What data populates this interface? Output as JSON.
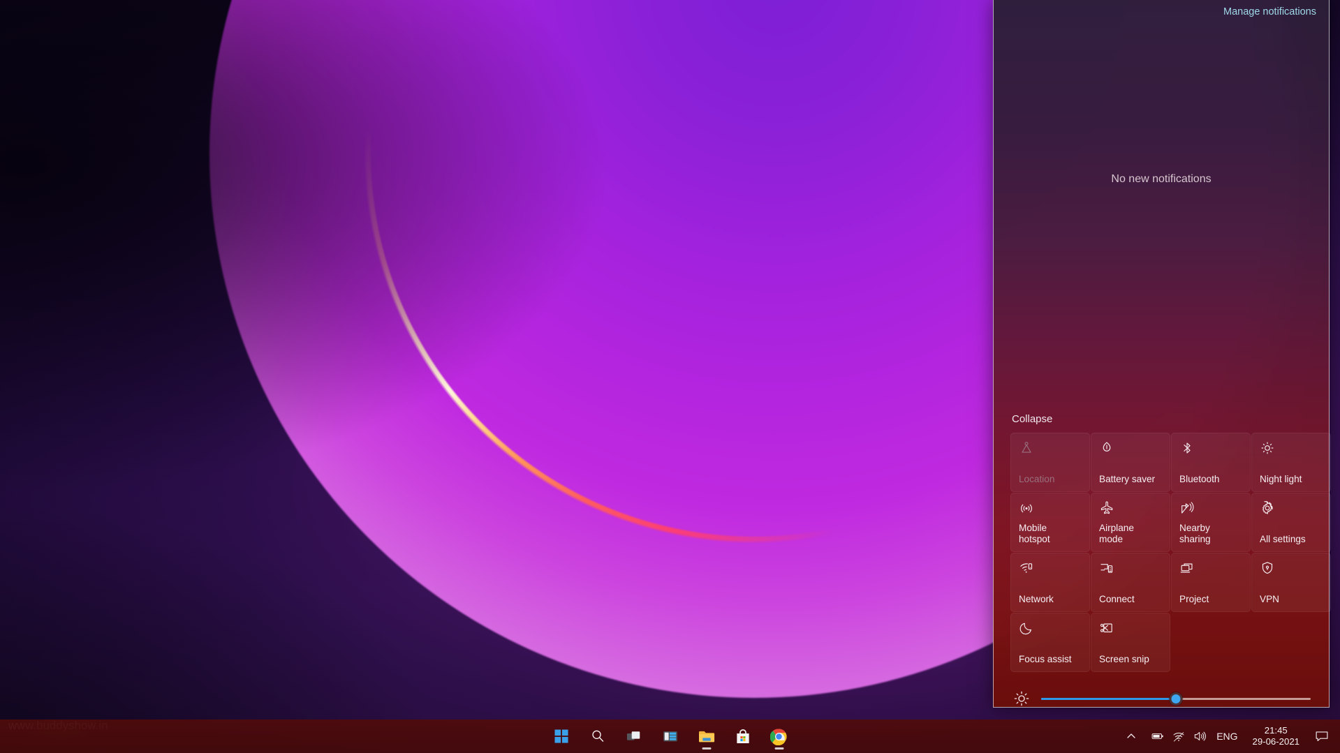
{
  "desktop": {
    "watermark": "www.buddyshow.in"
  },
  "action_center": {
    "manage_notifications": "Manage notifications",
    "no_notifications_text": "No new notifications",
    "collapse_label": "Collapse",
    "accent_color": "#2f9ae8",
    "link_color": "#9fd8e8",
    "quick_actions": [
      {
        "label": "Location",
        "icon": "location-icon",
        "enabled": false,
        "span": 1
      },
      {
        "label": "Battery saver",
        "icon": "battery-saver-icon",
        "enabled": true,
        "span": 1
      },
      {
        "label": "Bluetooth",
        "icon": "bluetooth-icon",
        "enabled": true,
        "span": 1
      },
      {
        "label": "Night light",
        "icon": "night-light-icon",
        "enabled": true,
        "span": 1
      },
      {
        "label": "Mobile\nhotspot",
        "icon": "mobile-hotspot-icon",
        "enabled": true,
        "span": 1
      },
      {
        "label": "Airplane\nmode",
        "icon": "airplane-mode-icon",
        "enabled": true,
        "span": 1
      },
      {
        "label": "Nearby\nsharing",
        "icon": "nearby-sharing-icon",
        "enabled": true,
        "span": 1
      },
      {
        "label": "All settings",
        "icon": "gear-icon",
        "enabled": true,
        "span": 1
      },
      {
        "label": "Network",
        "icon": "network-icon",
        "enabled": true,
        "span": 1
      },
      {
        "label": "Connect",
        "icon": "connect-icon",
        "enabled": true,
        "span": 1
      },
      {
        "label": "Project",
        "icon": "project-icon",
        "enabled": true,
        "span": 1
      },
      {
        "label": "VPN",
        "icon": "vpn-shield-icon",
        "enabled": true,
        "span": 1
      },
      {
        "label": "Focus assist",
        "icon": "moon-icon",
        "enabled": true,
        "span": 1
      },
      {
        "label": "Screen snip",
        "icon": "screen-snip-icon",
        "enabled": true,
        "span": 1
      }
    ],
    "brightness": {
      "icon": "brightness-icon",
      "value": 50,
      "min": 0,
      "max": 100
    }
  },
  "taskbar": {
    "buttons": [
      {
        "name": "start-button",
        "icon": "windows-logo-icon",
        "active": false
      },
      {
        "name": "search-button",
        "icon": "search-icon",
        "active": false
      },
      {
        "name": "task-view-button",
        "icon": "task-view-icon",
        "active": false
      },
      {
        "name": "widgets-button",
        "icon": "widgets-icon",
        "active": false
      },
      {
        "name": "file-explorer-button",
        "icon": "folder-icon",
        "active": true
      },
      {
        "name": "microsoft-store-button",
        "icon": "store-bag-icon",
        "active": false
      },
      {
        "name": "chrome-button",
        "icon": "chrome-icon",
        "active": true
      }
    ],
    "tray": {
      "overflow_icon": "chevron-up-icon",
      "battery_icon": "battery-icon",
      "network_icon": "wifi-icon",
      "volume_icon": "speaker-icon",
      "language": "ENG",
      "time": "21:45",
      "date": "29-06-2021",
      "notification_icon": "notification-bubble-icon"
    }
  }
}
